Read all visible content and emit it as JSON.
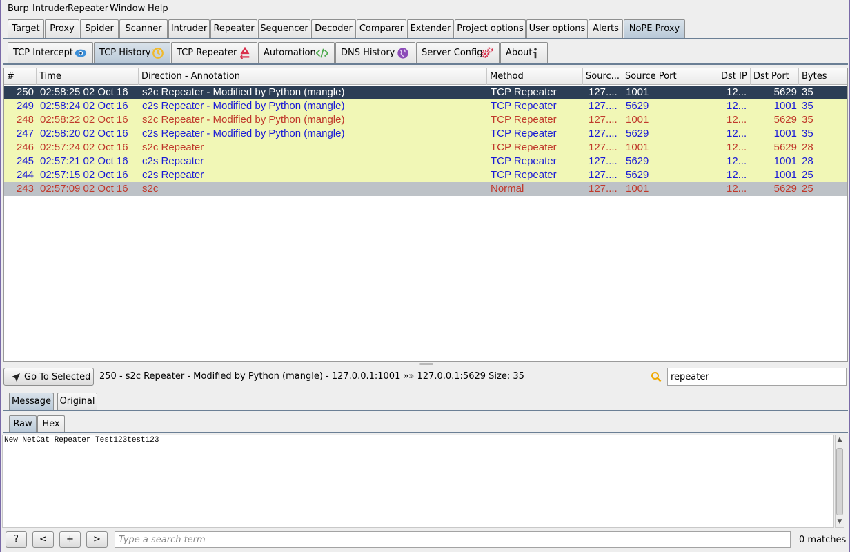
{
  "menubar": [
    "Burp",
    "Intruder",
    "Repeater",
    "Window",
    "Help"
  ],
  "main_tabs": [
    "Target",
    "Proxy",
    "Spider",
    "Scanner",
    "Intruder",
    "Repeater",
    "Sequencer",
    "Decoder",
    "Comparer",
    "Extender",
    "Project options",
    "User options",
    "Alerts",
    "NoPE Proxy"
  ],
  "main_tab_selected": "NoPE Proxy",
  "sub_tabs": [
    {
      "label": "TCP Intercept",
      "icon": "eye-icon"
    },
    {
      "label": "TCP History",
      "icon": "history-icon"
    },
    {
      "label": "TCP Repeater",
      "icon": "recycle-icon"
    },
    {
      "label": "Automation",
      "icon": "code-icon"
    },
    {
      "label": "DNS History",
      "icon": "globe-icon"
    },
    {
      "label": "Server Config",
      "icon": "gears-icon"
    },
    {
      "label": "About",
      "icon": "info-icon"
    }
  ],
  "sub_tab_selected": "TCP History",
  "table": {
    "columns": [
      "#",
      "Time",
      "Direction - Annotation",
      "Method",
      "Sourc...",
      "Source Port",
      "Dst IP",
      "Dst Port",
      "Bytes"
    ],
    "rows": [
      {
        "num": "250",
        "time": "02:58:25 02 Oct 16",
        "dir": "s2c Repeater  - Modified by Python (mangle)",
        "method": "TCP Repeater",
        "src": "127....",
        "sport": "1001",
        "dst": "12...",
        "dport": "5629",
        "bytes": "35",
        "style": "selected"
      },
      {
        "num": "249",
        "time": "02:58:24 02 Oct 16",
        "dir": "c2s Repeater  - Modified by Python (mangle)",
        "method": "TCP Repeater",
        "src": "127....",
        "sport": "5629",
        "dst": "12...",
        "dport": "1001",
        "bytes": "35",
        "style": "c2s"
      },
      {
        "num": "248",
        "time": "02:58:22 02 Oct 16",
        "dir": "s2c Repeater  - Modified by Python (mangle)",
        "method": "TCP Repeater",
        "src": "127....",
        "sport": "1001",
        "dst": "12...",
        "dport": "5629",
        "bytes": "35",
        "style": "s2c"
      },
      {
        "num": "247",
        "time": "02:58:20 02 Oct 16",
        "dir": "c2s Repeater  - Modified by Python (mangle)",
        "method": "TCP Repeater",
        "src": "127....",
        "sport": "5629",
        "dst": "12...",
        "dport": "1001",
        "bytes": "35",
        "style": "c2s"
      },
      {
        "num": "246",
        "time": "02:57:24 02 Oct 16",
        "dir": "s2c Repeater",
        "method": "TCP Repeater",
        "src": "127....",
        "sport": "1001",
        "dst": "12...",
        "dport": "5629",
        "bytes": "28",
        "style": "s2c"
      },
      {
        "num": "245",
        "time": "02:57:21 02 Oct 16",
        "dir": "c2s Repeater",
        "method": "TCP Repeater",
        "src": "127....",
        "sport": "5629",
        "dst": "12...",
        "dport": "1001",
        "bytes": "28",
        "style": "c2s"
      },
      {
        "num": "244",
        "time": "02:57:15 02 Oct 16",
        "dir": "c2s Repeater",
        "method": "TCP Repeater",
        "src": "127....",
        "sport": "5629",
        "dst": "12...",
        "dport": "1001",
        "bytes": "25",
        "style": "c2s"
      },
      {
        "num": "243",
        "time": "02:57:09 02 Oct 16",
        "dir": "s2c",
        "method": "Normal",
        "src": "127....",
        "sport": "1001",
        "dst": "12...",
        "dport": "5629",
        "bytes": "25",
        "style": "normal"
      }
    ]
  },
  "colors": {
    "selected_bg": "#2c3e55",
    "highlight_bg": "#f1f7b6",
    "normal_bg": "#bdc2c7",
    "c2s_text": "#1a1ad6",
    "s2c_text": "#c0392b",
    "tab_line": "#6b7f95"
  },
  "goto_button": "Go To Selected",
  "status_text": "250 - s2c Repeater  - Modified by Python (mangle) - 127.0.0.1:1001 »» 127.0.0.1:5629 Size: 35",
  "filter_value": "repeater",
  "message_tabs": [
    "Message",
    "Original"
  ],
  "message_tab_selected": "Message",
  "view_tabs": [
    "Raw",
    "Hex"
  ],
  "view_tab_selected": "Raw",
  "editor_content": "New NetCat Repeater Test123test123",
  "bottom": {
    "help": "?",
    "prev": "<",
    "add": "+",
    "next": ">",
    "search_placeholder": "Type a search term",
    "matches": "0 matches"
  }
}
